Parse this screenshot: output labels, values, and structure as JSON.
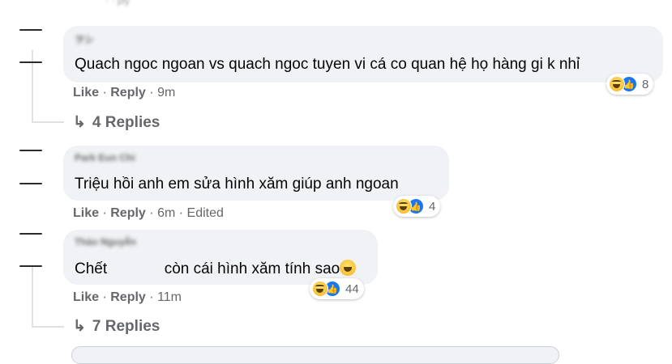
{
  "comments": [
    {
      "author": "ヲシ",
      "text": "Quach ngoc ngoan vs quach ngoc tuyen vi cá co quan hệ họ hàng gi k nhỉ",
      "like_label": "Like",
      "reply_label": "Reply",
      "time": "9m",
      "reaction_count": "8",
      "replies_label": "4 Replies"
    },
    {
      "author": "Park Eun Chi",
      "text": "Triệu hồi anh em sửa hình xăm giúp anh ngoan",
      "like_label": "Like",
      "reply_label": "Reply",
      "time": "6m",
      "edited_label": "Edited",
      "reaction_count": "4"
    },
    {
      "author": "Thảo Nguyễn",
      "text_before": "Chết",
      "text_after": "còn cái hình xăm tính sao",
      "like_label": "Like",
      "reply_label": "Reply",
      "time": "11m",
      "reaction_count": "44",
      "replies_label": "7 Replies"
    }
  ],
  "icons": {
    "reaction_haha": "haha-emoji-icon",
    "reaction_like": "like-thumb-icon",
    "reply_arrow": "reply-arrow-icon"
  },
  "colors": {
    "bubble": "#f0f2f5",
    "meta_text": "#65676b",
    "like_blue": "#1877f2"
  }
}
